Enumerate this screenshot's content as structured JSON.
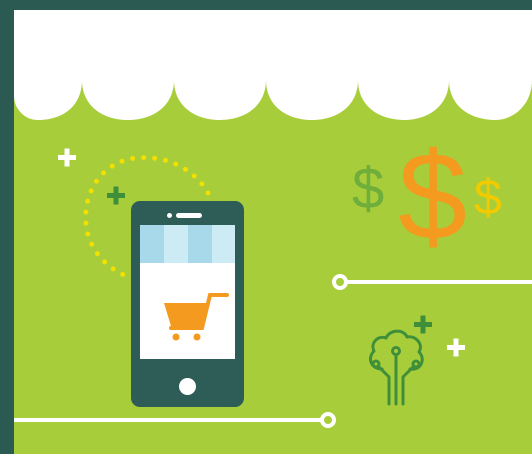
{
  "illustration": {
    "currency_symbols": {
      "left": "$",
      "middle": "$",
      "right": "$"
    },
    "colors": {
      "background": "#a8cd3a",
      "frame": "#2a5a52",
      "awning": "#ffffff",
      "phone_body": "#2d5d56",
      "phone_awning": "#a8d9ea",
      "cart": "#f39a1f",
      "dollar_left": "#6fae3b",
      "dollar_middle": "#f39a1f",
      "dollar_right": "#f2ca00",
      "dotted_arc": "#f2e000",
      "plus_dark": "#3f8f3a",
      "plus_light": "#ffffff",
      "tree": "#3f8f3a"
    },
    "icons": [
      "shop-awning",
      "smartphone-icon",
      "shopping-cart-icon",
      "dollar-sign-icon",
      "circuit-tree-icon",
      "plus-icon",
      "connector-line-icon"
    ]
  }
}
